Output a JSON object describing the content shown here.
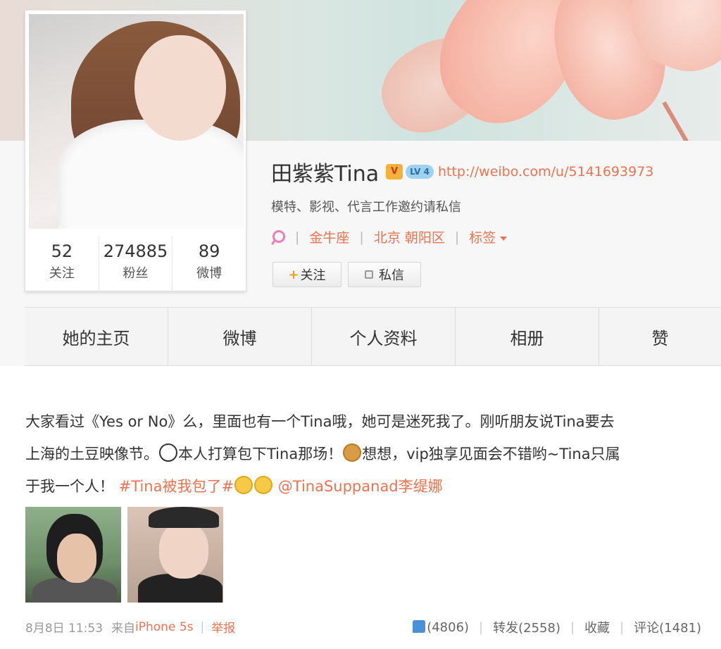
{
  "profile": {
    "name": "田紫紫Tina",
    "badge_v": "V",
    "level": "LV 4",
    "url": "http://weibo.com/u/5141693973",
    "bio": "模特、影视、代言工作邀约请私信",
    "zodiac": "金牛座",
    "location": "北京 朝阳区",
    "tags_label": "标签",
    "follow_button": "关注",
    "follow_plus": "+",
    "message_button": "私信"
  },
  "stats": [
    {
      "value": "52",
      "label": "关注"
    },
    {
      "value": "274885",
      "label": "粉丝"
    },
    {
      "value": "89",
      "label": "微博"
    }
  ],
  "tabs": [
    "她的主页",
    "微博",
    "个人资料",
    "相册",
    "赞"
  ],
  "post": {
    "line1": "大家看过《Yes or No》么，里面也有一个Tina哦，她可是迷死我了。刚听朋友说Tina要去",
    "line2a": "上海的土豆映像节。",
    "line2b": "本人打算包下Tina那场！",
    "line2c": "想想，vip独享见面会不错哟~Tina只属",
    "line3a": "于我一个人！",
    "hashtag": "#Tina被我包了#",
    "mention": "@TinaSuppanad李缇娜",
    "time": "8月8日 11:53",
    "from_label": "来自",
    "source": "iPhone 5s",
    "report": "举报",
    "likes": "(4806)",
    "repost": "转发(2558)",
    "favorite": "收藏",
    "comment": "评论(1481)"
  },
  "icons": {
    "location": "location-pin-icon",
    "like": "thumbs-up-icon",
    "message": "message-icon"
  },
  "colors": {
    "accent": "#eb7350",
    "link_pink": "#e97fb5",
    "follow_plus": "#f29c1f"
  }
}
